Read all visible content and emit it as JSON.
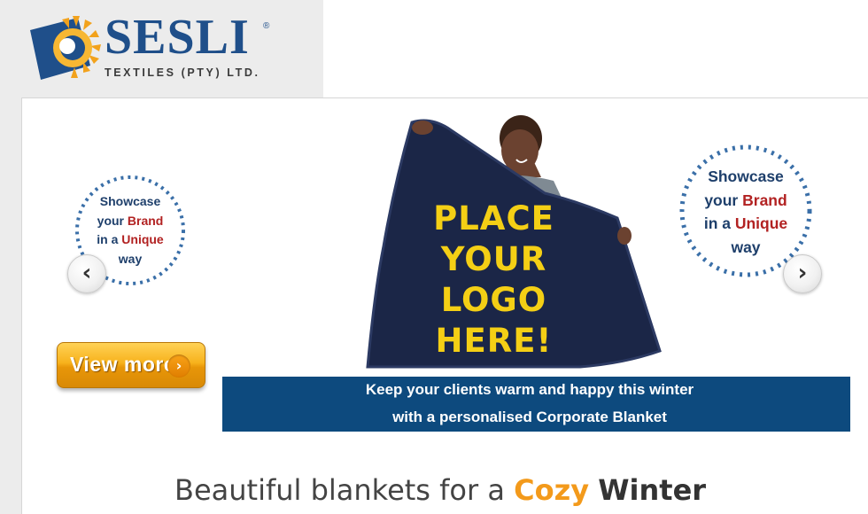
{
  "brand": {
    "name": "SESLI",
    "registered": "®",
    "subtitle": "TEXTILES (PTY) LTD."
  },
  "slider": {
    "badge_left": {
      "line1": "Showcase",
      "line2_pre": "your",
      "line2_hl": "Brand",
      "line3_pre": "in a",
      "line3_hl": "Unique",
      "line4": "way"
    },
    "badge_right": {
      "line1": "Showcase",
      "line2_pre": "your",
      "line2_hl": "Brand",
      "line3_pre": "in a",
      "line3_hl": "Unique",
      "line4": "way"
    },
    "prev_arrow": "‹",
    "next_arrow": "›",
    "view_more": "View more",
    "view_more_chevron": "›",
    "hero_lines": [
      "PLACE",
      "YOUR",
      "LOGO",
      "HERE!"
    ],
    "caption_line1": "Keep your clients warm and happy this winter",
    "caption_line2": "with a personalised Corporate Blanket"
  },
  "tagline": {
    "pre": "Beautiful blankets for a",
    "accent": "Cozy",
    "post": "Winter"
  },
  "colors": {
    "brand_blue": "#1f4f8a",
    "caption_bar": "#0d4a7e",
    "accent_orange": "#f39a1b",
    "hero_yellow": "#f4cf15",
    "highlight_red": "#b22222"
  }
}
